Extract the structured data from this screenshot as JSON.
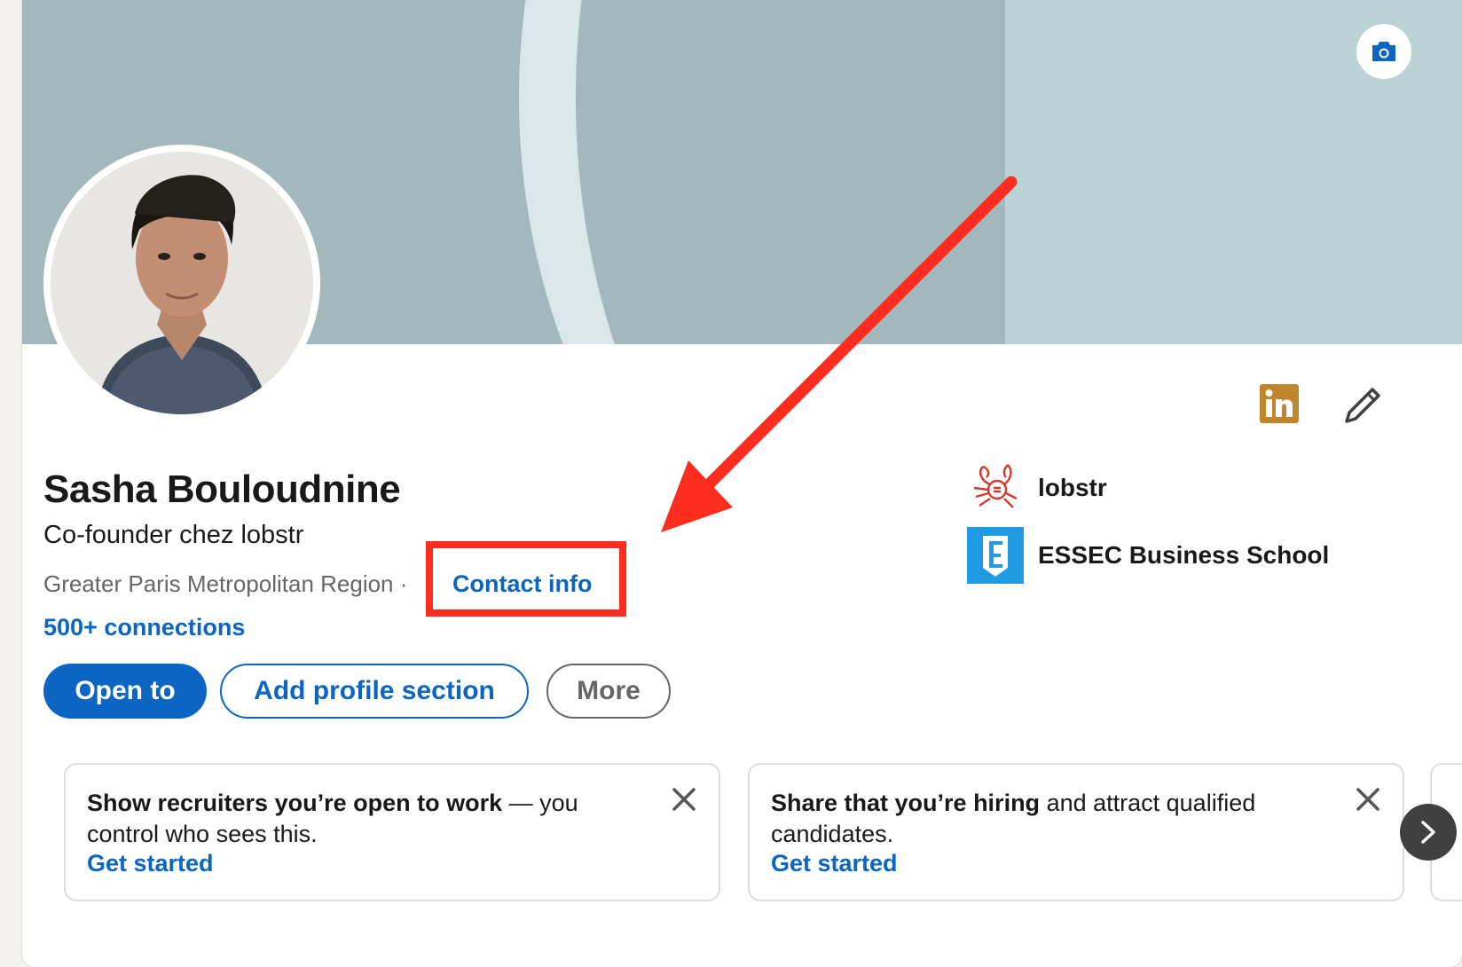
{
  "profile": {
    "name": "Sasha Bouloudnine",
    "headline": "Co-founder chez lobstr",
    "location": "Greater Paris Metropolitan Region",
    "separator": "·",
    "contact_info": "Contact info",
    "connections": "500+ connections"
  },
  "actions": {
    "open_to": "Open to",
    "add_section": "Add profile section",
    "more": "More"
  },
  "organizations": [
    {
      "name": "lobstr",
      "icon": "lobster-icon"
    },
    {
      "name": "ESSEC Business School",
      "icon": "essec-logo-icon"
    }
  ],
  "tips": [
    {
      "bold": "Show recruiters you’re open to work",
      "rest": " — you control who sees this.",
      "link": "Get started"
    },
    {
      "bold": "Share that you’re hiring",
      "rest": " and attract qualified candidates.",
      "link": "Get started"
    }
  ],
  "icons": {
    "banner_camera": "camera-icon",
    "linkedin_badge": "linkedin-icon",
    "edit": "pencil-icon",
    "next": "chevron-right-icon",
    "close": "close-icon"
  },
  "colors": {
    "accent": "#0a66c2",
    "annotation": "#ff2d1e",
    "linkedin_badge": "#c1852b",
    "banner": "#a2b8bd"
  }
}
